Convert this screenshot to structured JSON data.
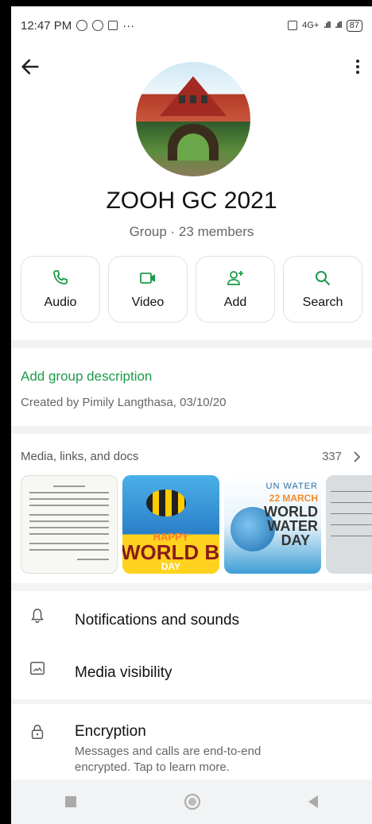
{
  "status_bar": {
    "time": "12:47 PM",
    "more": "···",
    "network": "4G+",
    "battery": "87"
  },
  "group": {
    "name": "ZOOH GC 2021",
    "subtitle": "Group · 23 members"
  },
  "actions": [
    {
      "label": "Audio",
      "icon": "phone-icon"
    },
    {
      "label": "Video",
      "icon": "video-icon"
    },
    {
      "label": "Add",
      "icon": "add-person-icon"
    },
    {
      "label": "Search",
      "icon": "search-icon"
    }
  ],
  "description": {
    "link": "Add group description",
    "created": "Created by Pimily Langthasa, 03/10/20"
  },
  "media": {
    "title": "Media, links, and docs",
    "count": "337",
    "thumb2": {
      "line1": "HAPPY",
      "line2": "WORLD BEE",
      "line3": "DAY"
    },
    "thumb3": {
      "line1": "UN WATER",
      "line2": "22 MARCH",
      "line3": "WORLD",
      "line4": "WATER",
      "line5": "DAY"
    }
  },
  "settings": {
    "notifications": "Notifications and sounds",
    "media_visibility": "Media visibility",
    "encryption_title": "Encryption",
    "encryption_sub": "Messages and calls are end-to-end encrypted. Tap to learn more."
  },
  "colors": {
    "accent": "#1c9a4a",
    "text_secondary": "#666666",
    "separator": "#f1f3f4"
  }
}
